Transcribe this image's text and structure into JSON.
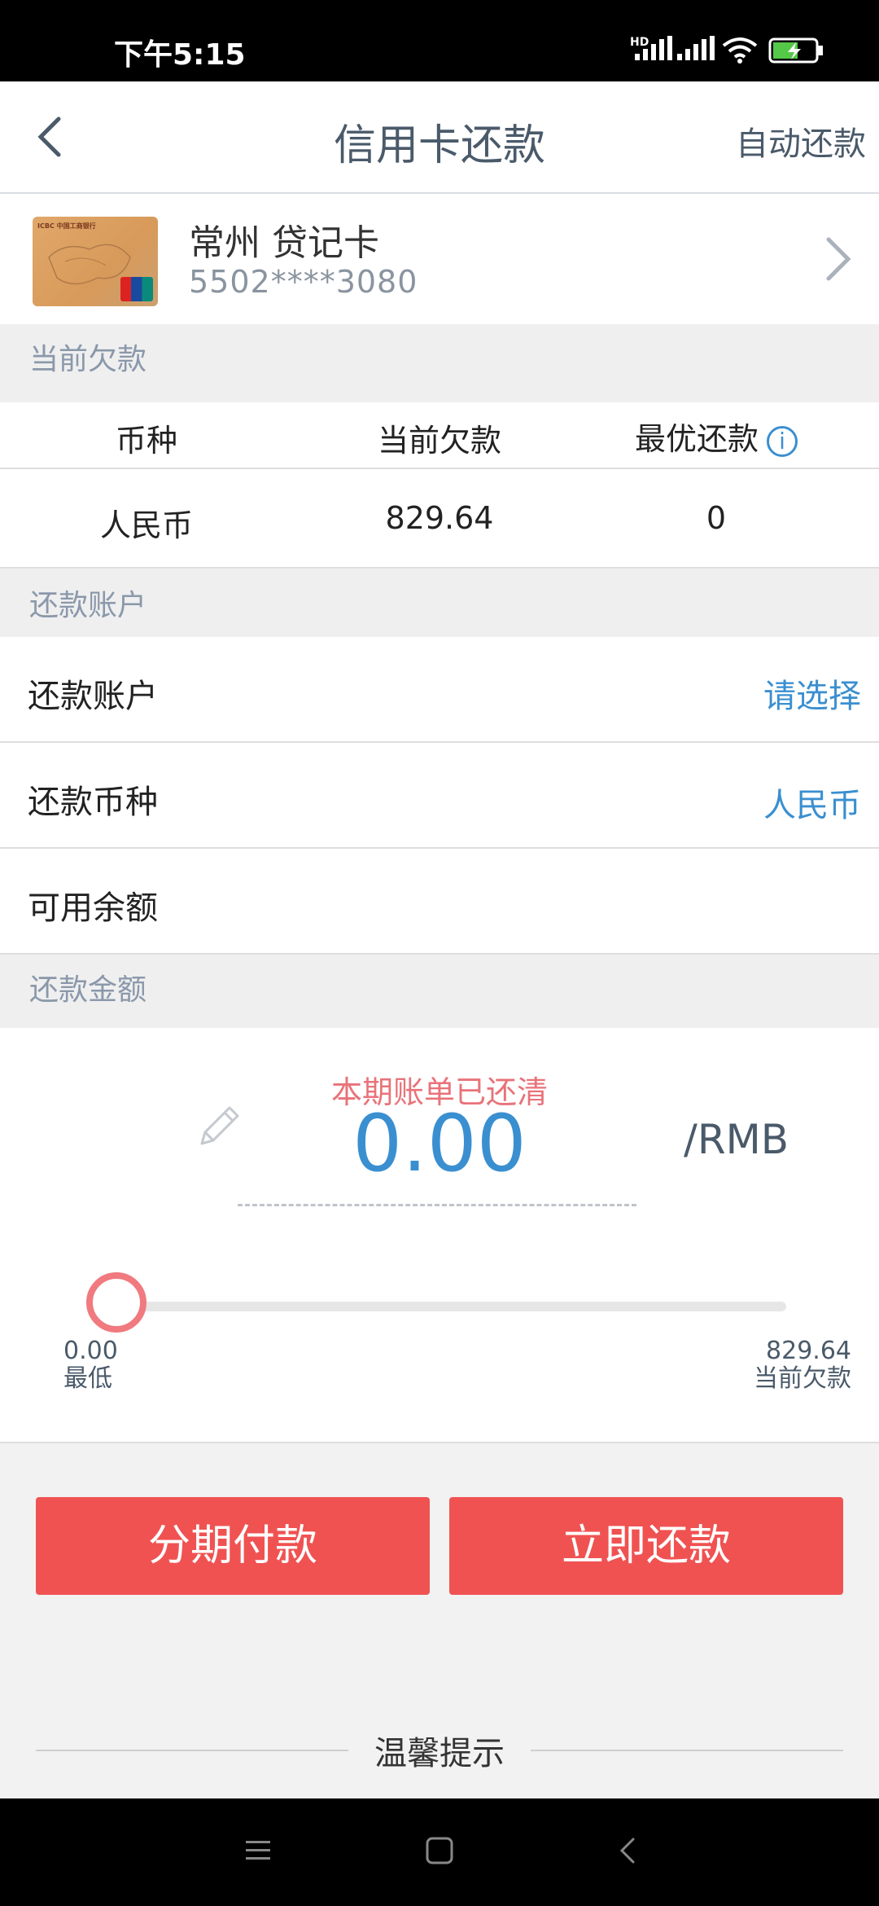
{
  "status_bar": {
    "time": "下午5:15",
    "network": "HD"
  },
  "header": {
    "title": "信用卡还款",
    "auto_repay": "自动还款"
  },
  "card": {
    "name": "常州 贷记卡",
    "number": "5502****3080",
    "brand_text": "ICBC 中国工商银行"
  },
  "sections": {
    "debt": "当前欠款",
    "account": "还款账户",
    "amount": "还款金额"
  },
  "debt_table": {
    "headers": [
      "币种",
      "当前欠款",
      "最优还款"
    ],
    "row": [
      "人民币",
      "829.64",
      "0"
    ]
  },
  "account_rows": [
    {
      "label": "还款账户",
      "value": "请选择"
    },
    {
      "label": "还款币种",
      "value": "人民币"
    },
    {
      "label": "可用余额",
      "value": ""
    }
  ],
  "amount": {
    "status": "本期账单已还清",
    "value": "0.00",
    "unit": "/RMB",
    "slider_min_value": "0.00",
    "slider_min_label": "最低",
    "slider_max_value": "829.64",
    "slider_max_label": "当前欠款",
    "slider_fraction": 0
  },
  "buttons": {
    "installment": "分期付款",
    "repay_now": "立即还款"
  },
  "tips": {
    "title": "温馨提示"
  },
  "colors": {
    "accent_blue": "#3a8fd0",
    "button_red": "#f05252",
    "status_pink": "#e8737a"
  }
}
